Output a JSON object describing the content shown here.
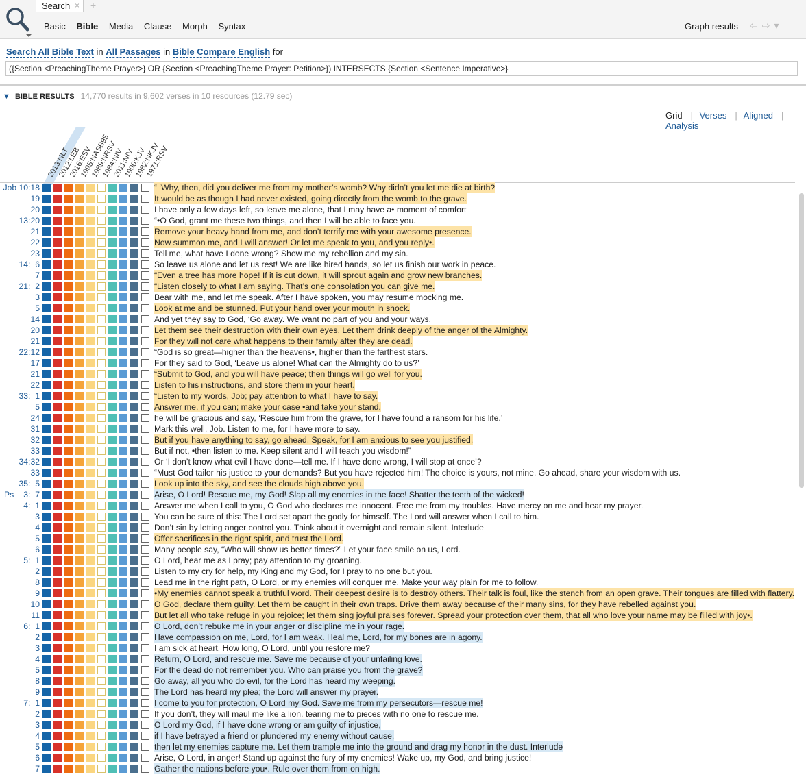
{
  "tab": {
    "label": "Search",
    "close": "×",
    "new": "+"
  },
  "subtabs": [
    "Basic",
    "Bible",
    "Media",
    "Clause",
    "Morph",
    "Syntax"
  ],
  "graph_results": "Graph results",
  "query": {
    "search_all": "Search All Bible Text",
    "in1": "in",
    "passages": "All Passages",
    "in2": "in",
    "compare": "Bible Compare English",
    "for": "for",
    "text": "({Section <PreachingTheme Prayer>} OR {Section <PreachingTheme Prayer: Petition>}) INTERSECTS {Section <Sentence Imperative>}"
  },
  "results": {
    "title": "BIBLE RESULTS",
    "stats": "14,770 results in 9,602 verses in 10 resources (12.79 sec)"
  },
  "views": [
    "Grid",
    "Verses",
    "Aligned",
    "Analysis"
  ],
  "columns": [
    "2013:NLT",
    "2012:LEB",
    "2016:ESV",
    "1995:NASB95",
    "1989:NRSV",
    "1984:NIV",
    "2011:NIV",
    "1900:KJV",
    "1982:NKJV",
    "1971:RSV"
  ],
  "colors": {
    "c1": "#1565a8",
    "c2": "#d8322a",
    "c3": "#ee6a10",
    "c4": "#f5a53a",
    "c5": "#fbd680",
    "c6": "#ffffff",
    "c7": "#4fbfb6",
    "c8": "#5a9bd4",
    "c9": "#4a6f8e",
    "link": "#1e5a96"
  },
  "rows": [
    {
      "book": "",
      "ref": "Job 10:18",
      "text": "“ ‘Why, then, did you deliver me from my mother’s womb? Why didn’t you let me die at birth?",
      "hl": "y"
    },
    {
      "book": "",
      "ref": "19",
      "text": "It would be as though I had never existed, going directly from the womb to the grave.",
      "hl": "y"
    },
    {
      "book": "",
      "ref": "20",
      "text": "I have only a few days left, so leave me alone, that I may have a• moment of comfort",
      "hl": ""
    },
    {
      "book": "",
      "ref": "13:20",
      "text": "“•O God, grant me these two things, and then I will be able to face you.",
      "hl": ""
    },
    {
      "book": "",
      "ref": "21",
      "text": "Remove your heavy hand from me, and don’t terrify me with your awesome presence.",
      "hl": "y"
    },
    {
      "book": "",
      "ref": "22",
      "text": "Now summon me, and I will answer! Or let me speak to you, and you reply•.",
      "hl": "y"
    },
    {
      "book": "",
      "ref": "23",
      "text": "Tell me, what have I done wrong? Show me my rebellion and my sin.",
      "hl": ""
    },
    {
      "book": "",
      "ref": "14:  6",
      "text": "So leave us alone and let us rest! We are like hired hands, so let us finish our work in peace.",
      "hl": ""
    },
    {
      "book": "",
      "ref": "7",
      "text": "“Even a tree has more hope! If it is cut down, it will sprout again and grow new branches.",
      "hl": "y"
    },
    {
      "book": "",
      "ref": "21:  2",
      "text": "“Listen closely to what I am saying. That’s one consolation you can give me.",
      "hl": "y"
    },
    {
      "book": "",
      "ref": "3",
      "text": "Bear with me, and let me speak. After I have spoken, you may resume mocking me.",
      "hl": ""
    },
    {
      "book": "",
      "ref": "5",
      "text": "Look at me and be stunned. Put your hand over your mouth in shock.",
      "hl": "y"
    },
    {
      "book": "",
      "ref": "14",
      "text": "And yet they say to God, ‘Go away. We want no part of you and your ways.",
      "hl": ""
    },
    {
      "book": "",
      "ref": "20",
      "text": "Let them see their destruction with their own eyes. Let them drink deeply of the anger of the Almighty.",
      "hl": "y"
    },
    {
      "book": "",
      "ref": "21",
      "text": "For they will not care what happens to their family after they are dead.",
      "hl": "y"
    },
    {
      "book": "",
      "ref": "22:12",
      "text": "“God is so great—higher than the heavens•, higher than the farthest stars.",
      "hl": ""
    },
    {
      "book": "",
      "ref": "17",
      "text": "For they said to God, ‘Leave us alone! What can the Almighty do to us?’",
      "hl": ""
    },
    {
      "book": "",
      "ref": "21",
      "text": "“Submit to God, and you will have peace; then things will go well for you.",
      "hl": "y"
    },
    {
      "book": "",
      "ref": "22",
      "text": "Listen to his instructions, and store them in your heart.",
      "hl": "y"
    },
    {
      "book": "",
      "ref": "33:  1",
      "text": "“Listen to my words, Job; pay attention to what I have to say.",
      "hl": "y"
    },
    {
      "book": "",
      "ref": "5",
      "text": "Answer me, if you can; make your case •and take your stand.",
      "hl": "y"
    },
    {
      "book": "",
      "ref": "24",
      "text": "he will be gracious and say, ‘Rescue him from the grave, for I have found a ransom for his life.’",
      "hl": ""
    },
    {
      "book": "",
      "ref": "31",
      "text": "Mark this well, Job. Listen to me, for I have more to say.",
      "hl": ""
    },
    {
      "book": "",
      "ref": "32",
      "text": "But if you have anything to say, go ahead. Speak, for I am anxious to see you justified.",
      "hl": "y"
    },
    {
      "book": "",
      "ref": "33",
      "text": "But if not, •then listen to me. Keep silent and I will teach you wisdom!”",
      "hl": ""
    },
    {
      "book": "",
      "ref": "34:32",
      "text": "Or ‘I don’t know what evil I have done—tell me. If I have done wrong, I will stop at once’?",
      "hl": ""
    },
    {
      "book": "",
      "ref": "33",
      "text": "“Must God tailor his justice to your demands? But you have rejected him! The choice is yours, not mine. Go ahead, share your wisdom with us.",
      "hl": ""
    },
    {
      "book": "",
      "ref": "35:  5",
      "text": "Look up into the sky, and see the clouds high above you.",
      "hl": "y"
    },
    {
      "book": "Ps",
      "ref": "3:  7",
      "text": "Arise, O Lord! Rescue me, my God! Slap all my enemies in the face! Shatter the teeth of the wicked!",
      "hl": "b"
    },
    {
      "book": "",
      "ref": "4:  1",
      "text": "Answer me when I call to you, O God who declares me innocent. Free me from my troubles. Have mercy on me and hear my prayer.",
      "hl": ""
    },
    {
      "book": "",
      "ref": "3",
      "text": "You can be sure of this: The Lord set apart the godly for himself. The Lord will answer when I call to him.",
      "hl": ""
    },
    {
      "book": "",
      "ref": "4",
      "text": "Don’t sin by letting anger control you. Think about it overnight and remain silent. Interlude",
      "hl": ""
    },
    {
      "book": "",
      "ref": "5",
      "text": "Offer sacrifices in the right spirit, and trust the Lord.",
      "hl": "y"
    },
    {
      "book": "",
      "ref": "6",
      "text": "Many people say, “Who will show us better times?” Let your face smile on us, Lord.",
      "hl": ""
    },
    {
      "book": "",
      "ref": "5:  1",
      "text": "O Lord, hear me as I pray; pay attention to my groaning.",
      "hl": ""
    },
    {
      "book": "",
      "ref": "2",
      "text": "Listen to my cry for help, my King and my God, for I pray to no one but you.",
      "hl": ""
    },
    {
      "book": "",
      "ref": "8",
      "text": "Lead me in the right path, O Lord, or my enemies will conquer me. Make your way plain for me to follow.",
      "hl": ""
    },
    {
      "book": "",
      "ref": "9",
      "text": "•My enemies cannot speak a truthful word. Their deepest desire is to destroy others. Their talk is foul, like the stench from an open grave. Their tongues are filled with flattery.",
      "hl": "y"
    },
    {
      "book": "",
      "ref": "10",
      "text": "O God, declare them guilty. Let them be caught in their own traps. Drive them away because of their many sins, for they have rebelled against you.",
      "hl": "y"
    },
    {
      "book": "",
      "ref": "11",
      "text": "But let all who take refuge in you rejoice; let them sing joyful praises forever. Spread your protection over them, that all who love your name may be filled with joy•.",
      "hl": "y"
    },
    {
      "book": "",
      "ref": "6:  1",
      "text": "O Lord, don’t rebuke me in your anger or discipline me in your rage.",
      "hl": "b"
    },
    {
      "book": "",
      "ref": "2",
      "text": "Have compassion on me, Lord, for I am weak. Heal me, Lord, for my bones are in agony.",
      "hl": "b"
    },
    {
      "book": "",
      "ref": "3",
      "text": "I am sick at heart. How long, O Lord, until you restore me?",
      "hl": ""
    },
    {
      "book": "",
      "ref": "4",
      "text": "Return, O Lord, and rescue me. Save me because of your unfailing love.",
      "hl": "b"
    },
    {
      "book": "",
      "ref": "5",
      "text": "For the dead do not remember you. Who can praise you from the grave?",
      "hl": "b"
    },
    {
      "book": "",
      "ref": "8",
      "text": "Go away, all you who do evil, for the Lord has heard my weeping.",
      "hl": "b"
    },
    {
      "book": "",
      "ref": "9",
      "text": "The Lord has heard my plea; the Lord will answer my prayer.",
      "hl": "b"
    },
    {
      "book": "",
      "ref": "7:  1",
      "text": "I come to you for protection, O Lord my God. Save me from my persecutors—rescue me!",
      "hl": "b"
    },
    {
      "book": "",
      "ref": "2",
      "text": "If you don’t, they will maul me like a lion, tearing me to pieces with no one to rescue me.",
      "hl": ""
    },
    {
      "book": "",
      "ref": "3",
      "text": "O Lord my God, if I have done wrong or am guilty of injustice,",
      "hl": "b"
    },
    {
      "book": "",
      "ref": "4",
      "text": "if I have betrayed a friend or plundered my enemy without cause,",
      "hl": "b"
    },
    {
      "book": "",
      "ref": "5",
      "text": "then let my enemies capture me. Let them trample me into the ground and drag my honor in the dust. Interlude",
      "hl": "b"
    },
    {
      "book": "",
      "ref": "6",
      "text": "Arise, O Lord, in anger! Stand up against the fury of my enemies! Wake up, my God, and bring justice!",
      "hl": ""
    },
    {
      "book": "",
      "ref": "7",
      "text": "Gather the nations before you•. Rule over them from on high.",
      "hl": "b"
    }
  ]
}
